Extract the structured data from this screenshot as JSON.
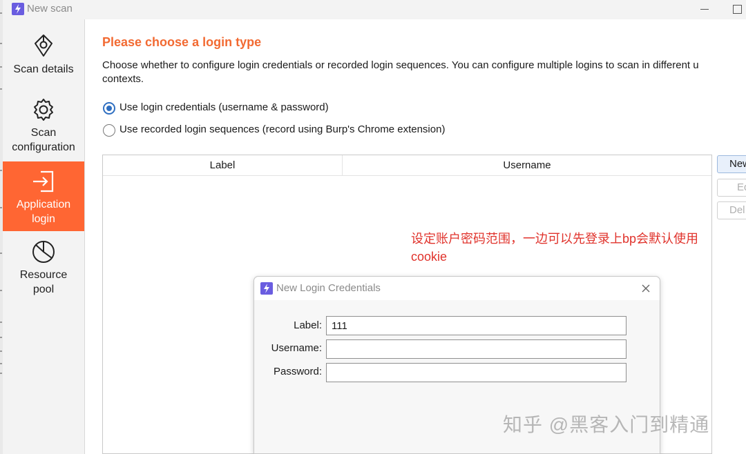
{
  "window": {
    "title": "New scan"
  },
  "nav": {
    "items": [
      {
        "label": "Scan details",
        "icon": "target-icon"
      },
      {
        "label": "Scan\nconfiguration",
        "icon": "gear-icon"
      },
      {
        "label": "Application\nlogin",
        "icon": "login-icon",
        "active": true
      },
      {
        "label": "Resource\npool",
        "icon": "pie-chart-icon"
      }
    ]
  },
  "main": {
    "heading": "Please choose a login type",
    "description": "Choose whether to configure login credentials or recorded login sequences. You can configure multiple logins to scan in different u",
    "description_line2": "contexts.",
    "options": [
      {
        "label": "Use login credentials (username & password)",
        "selected": true
      },
      {
        "label": "Use recorded login sequences (record using Burp's Chrome extension)",
        "selected": false
      }
    ],
    "table": {
      "columns": [
        "Label",
        "Username"
      ]
    },
    "buttons": {
      "new": "New",
      "edit": "Ed",
      "delete": "Del"
    }
  },
  "annotation": "设定账户密码范围，一边可以先登录上bp会默认使用cookie",
  "dialog": {
    "title": "New Login Credentials",
    "fields": {
      "label": {
        "label": "Label:",
        "value": "111"
      },
      "username": {
        "label": "Username:",
        "value": ""
      },
      "password": {
        "label": "Password:",
        "value": ""
      }
    }
  },
  "watermark": "知乎 @黑客入门到精通",
  "colors": {
    "accent": "#ff6633",
    "heading": "#f26a32",
    "annotation": "#e0322b",
    "radio": "#2f6fc1",
    "app_icon": "#6a5de0"
  }
}
